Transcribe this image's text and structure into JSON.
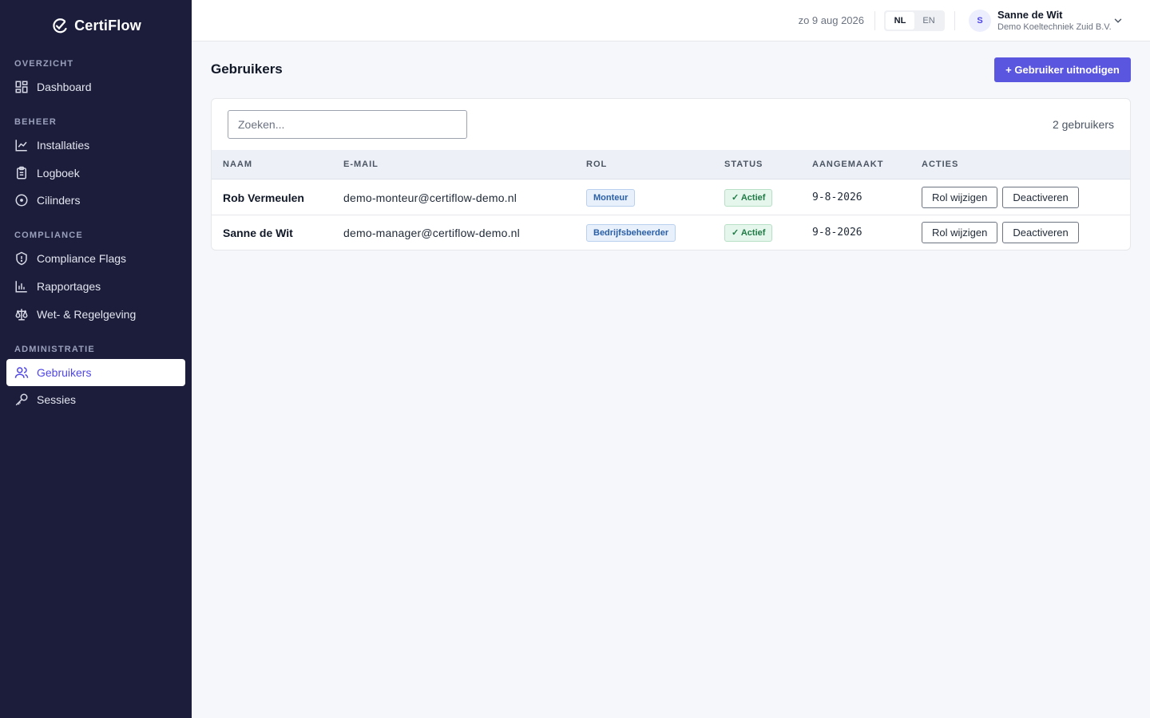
{
  "app": {
    "name": "CertiFlow"
  },
  "sidebar": {
    "sections": [
      {
        "title": "OVERZICHT",
        "items": [
          {
            "label": "Dashboard",
            "icon": "dashboard-icon"
          }
        ]
      },
      {
        "title": "BEHEER",
        "items": [
          {
            "label": "Installaties",
            "icon": "chart-area-icon"
          },
          {
            "label": "Logboek",
            "icon": "clipboard-icon"
          },
          {
            "label": "Cilinders",
            "icon": "circle-dot-icon"
          }
        ]
      },
      {
        "title": "COMPLIANCE",
        "items": [
          {
            "label": "Compliance Flags",
            "icon": "shield-icon"
          },
          {
            "label": "Rapportages",
            "icon": "bar-chart-icon"
          },
          {
            "label": "Wet- & Regelgeving",
            "icon": "scale-icon"
          }
        ]
      },
      {
        "title": "ADMINISTRATIE",
        "items": [
          {
            "label": "Gebruikers",
            "icon": "users-icon",
            "active": true
          },
          {
            "label": "Sessies",
            "icon": "key-icon"
          }
        ]
      }
    ]
  },
  "header": {
    "date": "zo 9 aug 2026",
    "languages": [
      "NL",
      "EN"
    ],
    "active_language": "NL",
    "user": {
      "initial": "S",
      "name": "Sanne de Wit",
      "org": "Demo Koeltechniek Zuid B.V."
    }
  },
  "main": {
    "title": "Gebruikers",
    "invite_label": "+ Gebruiker uitnodigen",
    "search_placeholder": "Zoeken...",
    "count_label": "2 gebruikers",
    "columns": [
      "NAAM",
      "E-MAIL",
      "ROL",
      "STATUS",
      "AANGEMAAKT",
      "ACTIES"
    ],
    "rows": [
      {
        "name": "Rob Vermeulen",
        "email": "demo-monteur@certiflow-demo.nl",
        "role": "Monteur",
        "status": "✓ Actief",
        "created": "9-8-2026",
        "action_role": "Rol wijzigen",
        "action_deactivate": "Deactiveren"
      },
      {
        "name": "Sanne de Wit",
        "email": "demo-manager@certiflow-demo.nl",
        "role": "Bedrijfsbeheerder",
        "status": "✓ Actief",
        "created": "9-8-2026",
        "action_role": "Rol wijzigen",
        "action_deactivate": "Deactiveren"
      }
    ]
  },
  "colors": {
    "sidebar_bg": "#1c1d3a",
    "accent": "#5b56e0",
    "active_text": "#4f46e5",
    "status_green": "#1f7a45",
    "role_blue": "#2b5fa6"
  }
}
